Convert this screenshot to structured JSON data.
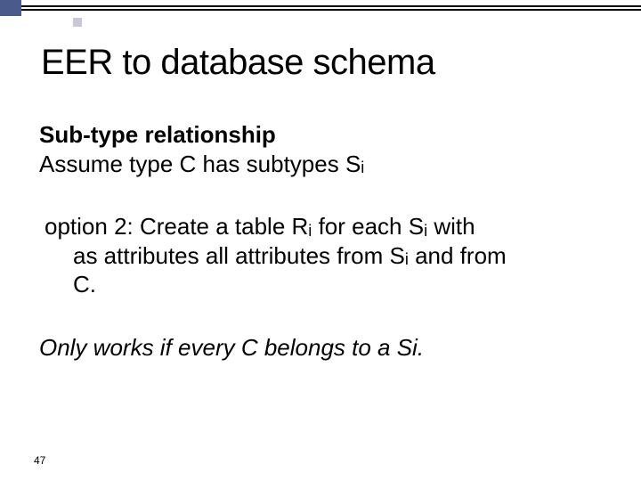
{
  "slide": {
    "title": "EER to database schema",
    "subtype_label": "Sub-type relationship",
    "assume_prefix": "Assume type C has subtypes S",
    "sub_i": "i",
    "option2_line1a": "option 2: Create a table R",
    "option2_line1b": " for each S",
    "option2_line1c": " with",
    "option2_line2a": "as attributes all attributes from S",
    "option2_line2b": " and from",
    "option2_line3": "C.",
    "note": "Only works if every C belongs to a Si.",
    "page_number": "47"
  }
}
